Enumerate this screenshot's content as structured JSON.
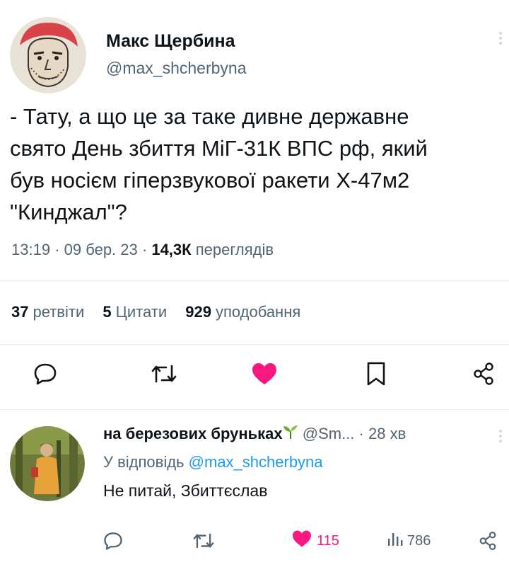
{
  "tweet": {
    "author_name": "Макс Щербина",
    "author_handle": "@max_shcherbyna",
    "text_lines": [
      "- Тату, а що це за таке дивне державне",
      "свято День збиття МіГ-31К ВПС рф, який",
      "був носієм гіперзвукової ракети Х-47м2",
      "\"Кинджал\"?"
    ],
    "time": "13:19",
    "date": "09 бер. 23",
    "views_count": "14,3К",
    "views_label": "переглядів",
    "separator": "·",
    "stats": [
      {
        "count": "37",
        "label": "ретвіти"
      },
      {
        "count": "5",
        "label": "Цитати"
      },
      {
        "count": "929",
        "label": "уподобання"
      }
    ],
    "actions": [
      "reply-icon",
      "retweet-icon",
      "like-icon",
      "bookmark-icon",
      "share-icon"
    ]
  },
  "reply": {
    "author_name": "на березових бруньках",
    "author_handle": "@Sm...",
    "time": "· 28 хв",
    "reply_to_prefix": "У відповідь",
    "reply_to_handle": "@max_shcherbyna",
    "text": "Не питай, Збиттєслав",
    "likes": "115",
    "views": "786",
    "actions": [
      "reply-icon",
      "retweet-icon",
      "like-icon",
      "views-icon",
      "share-icon"
    ]
  },
  "colors": {
    "text": "#0f1419",
    "muted": "#536471",
    "link": "#1d9bf0",
    "like": "#f91880",
    "divider": "#e6ecf0"
  }
}
